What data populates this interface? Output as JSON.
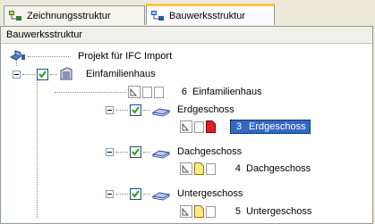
{
  "tabs": [
    {
      "label": "Zeichnungsstruktur",
      "icon": "drawing-structure-icon",
      "active": false
    },
    {
      "label": "Bauwerksstruktur",
      "icon": "building-structure-icon",
      "active": true
    }
  ],
  "header": {
    "title": "Bauwerksstruktur"
  },
  "tree": {
    "root": {
      "label": "Projekt für IFC Import"
    },
    "building": {
      "label": "Einfamilienhaus",
      "checked": true
    },
    "building_file": {
      "number": "6",
      "label": "Einfamilienhaus"
    },
    "floors": [
      {
        "label": "Erdgeschoss",
        "checked": true,
        "file": {
          "number": "3",
          "label": "Erdgeschoss",
          "selected": true,
          "doc_color": "red"
        }
      },
      {
        "label": "Dachgeschoss",
        "checked": true,
        "file": {
          "number": "4",
          "label": "Dachgeschoss",
          "selected": false,
          "doc_color": "yellow"
        }
      },
      {
        "label": "Untergeschoss",
        "checked": true,
        "file": {
          "number": "5",
          "label": "Untergeschoss",
          "selected": false,
          "doc_color": "yellow"
        }
      }
    ]
  },
  "colors": {
    "selection": "#316ac5",
    "tab_highlight": "#ffc83c",
    "red_doc": "#e02020",
    "yellow_doc": "#ffe880"
  }
}
